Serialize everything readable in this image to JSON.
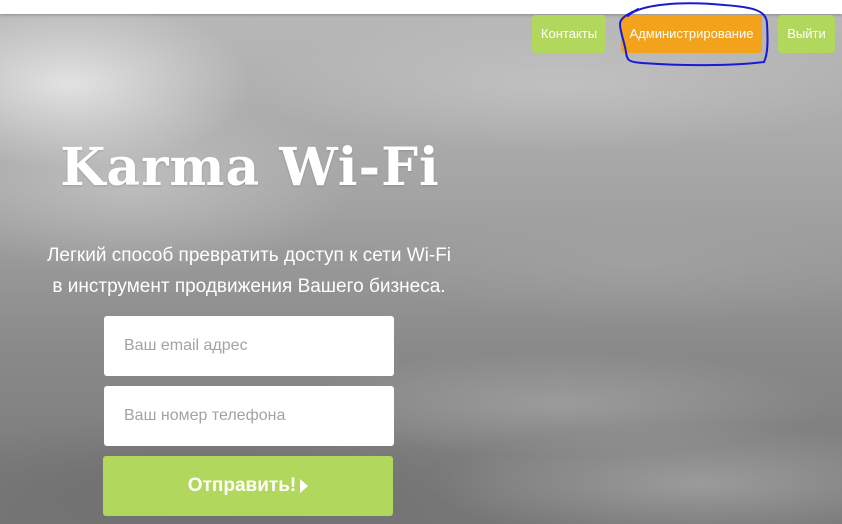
{
  "nav": {
    "contacts_label": "Контакты",
    "admin_label": "Администрирование",
    "logout_label": "Выйти"
  },
  "hero": {
    "title": "Karma Wi-Fi",
    "tagline_line1": "Легкий способ превратить доступ к сети Wi-Fi",
    "tagline_line2": "в инструмент продвижения Вашего бизнеса."
  },
  "form": {
    "email_placeholder": "Ваш email адрес",
    "email_value": "",
    "phone_placeholder": "Ваш номер телефона",
    "phone_value": "",
    "submit_label": "Отправить!",
    "submit_icon": "play-arrow-icon"
  },
  "colors": {
    "accent_green": "#b1d85c",
    "accent_orange": "#f3a21b",
    "highlight_blue": "#1a1ad6",
    "topbar": "#ffffff"
  }
}
